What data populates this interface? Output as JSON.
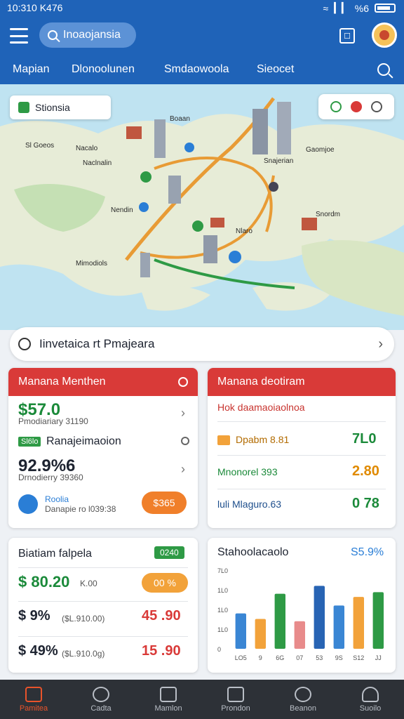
{
  "status": {
    "time": "10:310 K476",
    "signal": "%6"
  },
  "header": {
    "search_label": "Inoaojansia"
  },
  "tabs": [
    "Mapian",
    "Dlonoolunen",
    "Smdaowoola",
    "Sieocet"
  ],
  "map": {
    "region_chip": "Stionsia",
    "labels": [
      "Sl Goeos",
      "Nacalo",
      "Naclnalin",
      "Boaan",
      "Gaomjoe",
      "Snajerian",
      "Nendin",
      "Mimodiols",
      "Nlaro",
      "Snordm"
    ]
  },
  "route_bar": {
    "text": "Iinvetaica rt Pmajeara"
  },
  "card_left_top": {
    "title": "Manana Menthen",
    "primary_value": "$57.0",
    "primary_sub": "Pmodiariary 31190",
    "row_label": "Ranajeimaoion",
    "row_badge": "Sl6lo",
    "percent_value": "92.9%6",
    "percent_sub": "Drnodierry 39360",
    "footer_title": "Roolia",
    "footer_sub": "Danapie ro l039:38",
    "footer_pill": "$365"
  },
  "card_right_top": {
    "title": "Manana deotiram",
    "subtitle": "Hok daamaoiaolnoa",
    "rows": [
      {
        "label": "Dpabm 8.81",
        "value": "7L0"
      },
      {
        "label": "Mnonorel 393",
        "value": "2.80"
      },
      {
        "label": "luli Mlaguro.63",
        "value": "0 78"
      }
    ]
  },
  "card_left_bottom": {
    "title": "Biatiam falpela",
    "title_badge": "0240",
    "rows": [
      {
        "value": "$ 80.20",
        "sub": "K.00",
        "pill": "00 %"
      },
      {
        "value": "$ 9%",
        "sub": "($L.910.00)",
        "pill": "45 .90"
      },
      {
        "value": "$ 49%",
        "sub": "($L.910.0g)",
        "pill": "15 .90"
      }
    ]
  },
  "card_right_bottom": {
    "title": "Stahoolacaolo",
    "badge": "S5.9%",
    "chart_data": {
      "type": "bar",
      "y_ticks": [
        "7L0",
        "1L0",
        "1L0",
        "1L0",
        "0"
      ],
      "categories": [
        "LO5",
        "9",
        "6G",
        "07",
        "53",
        "9S",
        "S12",
        "JJ"
      ],
      "series_colors": [
        "#3a86d4",
        "#f2a23a",
        "#2e9a45",
        "#e88b8b",
        "#2864b4"
      ],
      "values": [
        45,
        38,
        70,
        35,
        80,
        55,
        66,
        72
      ]
    }
  },
  "nav": [
    {
      "label": "Pamitea",
      "active": true
    },
    {
      "label": "Cadta",
      "active": false
    },
    {
      "label": "Mamlon",
      "active": false
    },
    {
      "label": "Prondon",
      "active": false
    },
    {
      "label": "Beanon",
      "active": false
    },
    {
      "label": "Suoilo",
      "active": false
    }
  ]
}
